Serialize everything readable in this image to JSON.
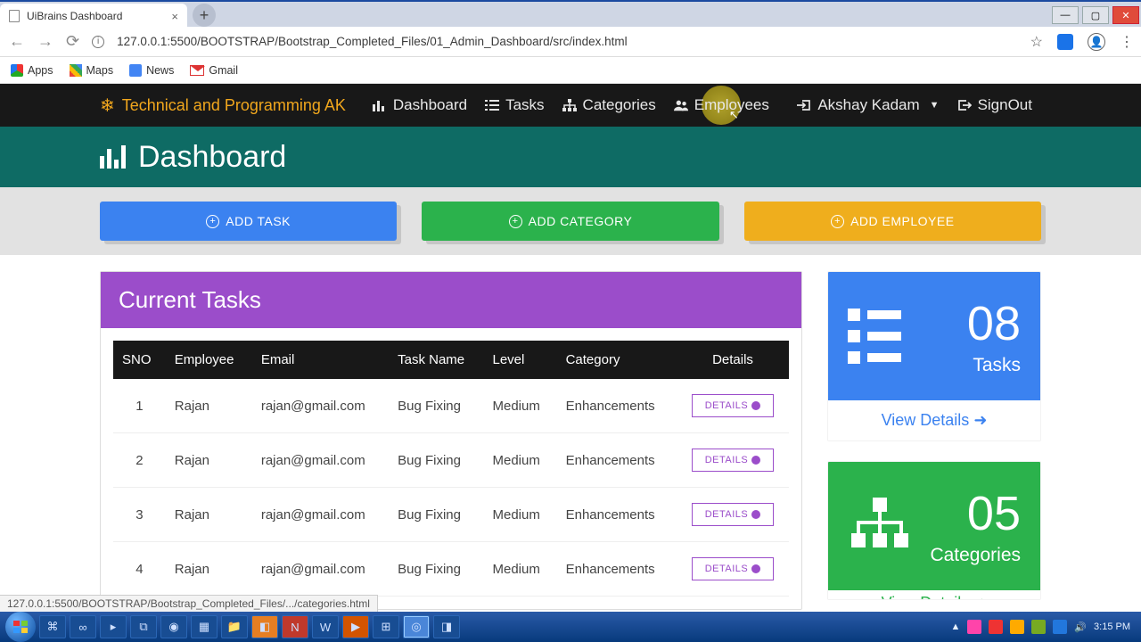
{
  "browser": {
    "tab_title": "UiBrains Dashboard",
    "url": "127.0.0.1:5500/BOOTSTRAP/Bootstrap_Completed_Files/01_Admin_Dashboard/src/index.html",
    "bookmarks": [
      "Apps",
      "Maps",
      "News",
      "Gmail"
    ],
    "status_url": "127.0.0.1:5500/BOOTSTRAP/Bootstrap_Completed_Files/.../categories.html"
  },
  "navbar": {
    "brand": "Technical and Programming AK",
    "items": [
      "Dashboard",
      "Tasks",
      "Categories",
      "Employees"
    ],
    "user": "Akshay Kadam",
    "signout": "SignOut"
  },
  "header": {
    "title": "Dashboard"
  },
  "actions": {
    "add_task": "ADD TASK",
    "add_category": "ADD CATEGORY",
    "add_employee": "ADD EMPLOYEE"
  },
  "tasks_card": {
    "title": "Current Tasks",
    "columns": [
      "SNO",
      "Employee",
      "Email",
      "Task Name",
      "Level",
      "Category",
      "Details"
    ],
    "details_btn": "DETAILS",
    "rows": [
      {
        "sno": "1",
        "employee": "Rajan",
        "email": "rajan@gmail.com",
        "task": "Bug Fixing",
        "level": "Medium",
        "category": "Enhancements"
      },
      {
        "sno": "2",
        "employee": "Rajan",
        "email": "rajan@gmail.com",
        "task": "Bug Fixing",
        "level": "Medium",
        "category": "Enhancements"
      },
      {
        "sno": "3",
        "employee": "Rajan",
        "email": "rajan@gmail.com",
        "task": "Bug Fixing",
        "level": "Medium",
        "category": "Enhancements"
      },
      {
        "sno": "4",
        "employee": "Rajan",
        "email": "rajan@gmail.com",
        "task": "Bug Fixing",
        "level": "Medium",
        "category": "Enhancements"
      }
    ]
  },
  "stats": {
    "tasks": {
      "count": "08",
      "label": "Tasks",
      "view": "View Details"
    },
    "categories": {
      "count": "05",
      "label": "Categories",
      "view": "View Details"
    }
  },
  "taskbar": {
    "time": "3:15 PM"
  }
}
